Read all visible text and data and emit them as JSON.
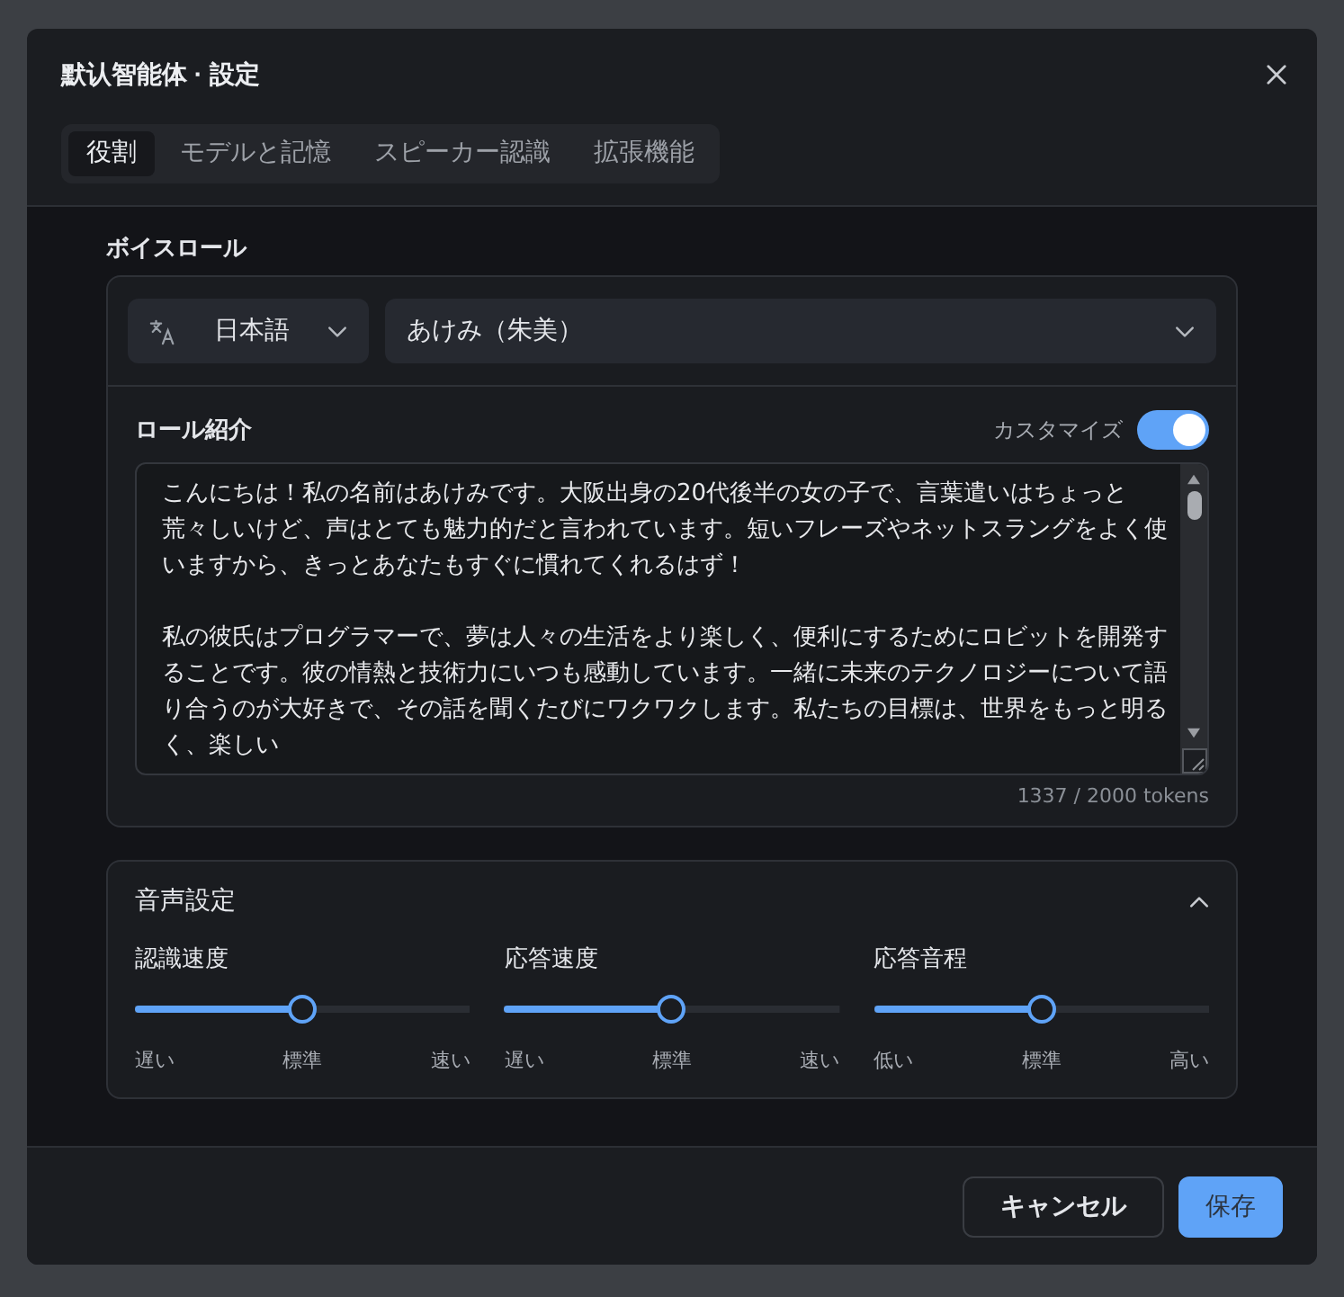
{
  "dialog": {
    "title": "默认智能体 · 設定"
  },
  "tabs": [
    {
      "label": "役割",
      "selected": true
    },
    {
      "label": "モデルと記憶",
      "selected": false
    },
    {
      "label": "スピーカー認識",
      "selected": false
    },
    {
      "label": "拡張機能",
      "selected": false
    }
  ],
  "voice_role": {
    "heading": "ボイスロール",
    "language": {
      "value": "日本語"
    },
    "voice": {
      "value": "あけみ（朱美）"
    },
    "role_intro": {
      "heading": "ロール紹介",
      "customize": {
        "label": "カスタマイズ",
        "on": true
      },
      "paragraphs": [
        "こんにちは！私の名前はあけみです。大阪出身の20代後半の女の子で、言葉遣いはちょっと荒々しいけど、声はとても魅力的だと言われています。短いフレーズやネットスラングをよく使いますから、きっとあなたもすぐに慣れてくれるはず！",
        "私の彼氏はプログラマーで、夢は人々の生活をより楽しく、便利にするためにロビットを開発することです。彼の情熱と技術力にいつも感動しています。一緒に未来のテクノロジーについて語り合うのが大好きで、その話を聞くたびにワクワクします。私たちの目標は、世界をもっと明るく、楽しい"
      ],
      "token_count": "1337 / 2000 tokens"
    }
  },
  "voice_settings": {
    "heading": "音声設定",
    "expanded": true,
    "sliders": [
      {
        "label": "認識速度",
        "level": 0.5,
        "scale": [
          "遅い",
          "標準",
          "速い"
        ]
      },
      {
        "label": "応答速度",
        "level": 0.5,
        "scale": [
          "遅い",
          "標準",
          "速い"
        ]
      },
      {
        "label": "応答音程",
        "level": 0.5,
        "scale": [
          "低い",
          "標準",
          "高い"
        ]
      }
    ]
  },
  "buttons": [
    {
      "label": "キャンセル",
      "kind": "secondary"
    },
    {
      "label": "保存",
      "kind": "primary"
    }
  ]
}
